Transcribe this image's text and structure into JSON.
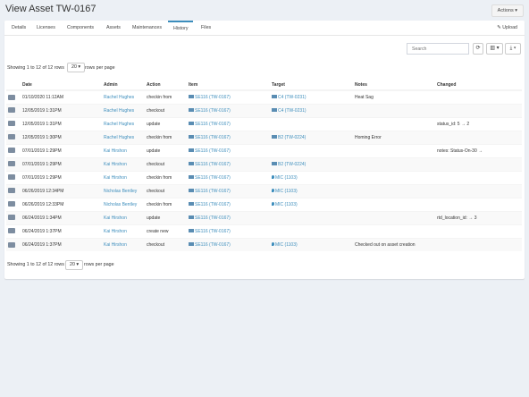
{
  "page": {
    "title": "View Asset TW-0167",
    "actions_label": "Actions ▾"
  },
  "tabs": [
    {
      "label": "Details"
    },
    {
      "label": "Licenses"
    },
    {
      "label": "Components"
    },
    {
      "label": "Assets"
    },
    {
      "label": "Maintenances"
    },
    {
      "label": "History"
    },
    {
      "label": "Files"
    }
  ],
  "upload_label": "✎ Upload",
  "toolbar": {
    "search_placeholder": "Search",
    "refresh_icon": "⟳",
    "columns_icon": "▥ ▾",
    "export_icon": "⤓ ▾"
  },
  "pagination": {
    "showing_top": "Showing 1 to 12 of 12 rows",
    "showing_bottom": "Showing 1 to 12 of 12 rows",
    "rows_per_page_value": "20 ▾",
    "rows_per_page_label": "rows per page"
  },
  "table": {
    "headers": [
      "Date",
      "Admin",
      "Action",
      "Item",
      "Target",
      "Notes",
      "Changed"
    ],
    "rows": [
      {
        "date": "01/10/2020 11:12AM",
        "admin": "Rachel Hughes",
        "action": "checkin from",
        "item": "SE116 (TW-0167)",
        "target": "C4 (TW-0231)",
        "target_type": "asset",
        "notes": "Heat Sag",
        "changed": ""
      },
      {
        "date": "12/05/2019 1:31PM",
        "admin": "Rachel Hughes",
        "action": "checkout",
        "item": "SE116 (TW-0167)",
        "target": "C4 (TW-0231)",
        "target_type": "asset",
        "notes": "",
        "changed": ""
      },
      {
        "date": "12/05/2019 1:31PM",
        "admin": "Rachel Hughes",
        "action": "update",
        "item": "SE116 (TW-0167)",
        "target": "",
        "target_type": "",
        "notes": "",
        "changed": "status_id: 5 → 2"
      },
      {
        "date": "12/05/2019 1:30PM",
        "admin": "Rachel Hughes",
        "action": "checkin from",
        "item": "SE116 (TW-0167)",
        "target": "B2 (TW-0224)",
        "target_type": "asset",
        "notes": "Homing Error",
        "changed": ""
      },
      {
        "date": "07/01/2019 1:29PM",
        "admin": "Kai Hirshon",
        "action": "update",
        "item": "SE116 (TW-0167)",
        "target": "",
        "target_type": "",
        "notes": "",
        "changed": "notes: Status-On-30 →"
      },
      {
        "date": "07/01/2019 1:29PM",
        "admin": "Kai Hirshon",
        "action": "checkout",
        "item": "SE116 (TW-0167)",
        "target": "B2 (TW-0224)",
        "target_type": "asset",
        "notes": "",
        "changed": ""
      },
      {
        "date": "07/01/2019 1:29PM",
        "admin": "Kai Hirshon",
        "action": "checkin from",
        "item": "SE116 (TW-0167)",
        "target": "MIC (1103)",
        "target_type": "location",
        "notes": "",
        "changed": ""
      },
      {
        "date": "06/26/2019 12:34PM",
        "admin": "Nicholas Bentley",
        "action": "checkout",
        "item": "SE116 (TW-0167)",
        "target": "MIC (1103)",
        "target_type": "location",
        "notes": "",
        "changed": ""
      },
      {
        "date": "06/26/2019 12:33PM",
        "admin": "Nicholas Bentley",
        "action": "checkin from",
        "item": "SE116 (TW-0167)",
        "target": "MIC (1103)",
        "target_type": "location",
        "notes": "",
        "changed": ""
      },
      {
        "date": "06/24/2019 1:34PM",
        "admin": "Kai Hirshon",
        "action": "update",
        "item": "SE116 (TW-0167)",
        "target": "",
        "target_type": "",
        "notes": "",
        "changed": "rtd_location_id: → 3"
      },
      {
        "date": "06/24/2019 1:37PM",
        "admin": "Kai Hirshon",
        "action": "create new",
        "item": "SE116 (TW-0167)",
        "target": "",
        "target_type": "",
        "notes": "",
        "changed": ""
      },
      {
        "date": "06/24/2019 1:37PM",
        "admin": "Kai Hirshon",
        "action": "checkout",
        "item": "SE116 (TW-0167)",
        "target": "MIC (1103)",
        "target_type": "location",
        "notes": "Checked out on asset creation",
        "changed": ""
      }
    ]
  }
}
